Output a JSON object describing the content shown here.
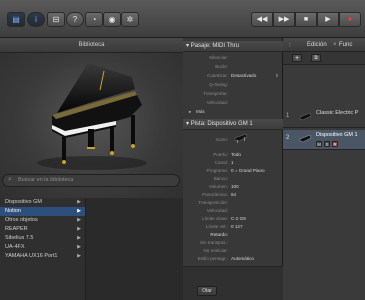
{
  "transport": {
    "rewind": "◀◀",
    "forward": "▶▶",
    "stop": "■",
    "play": "▶",
    "record": "●"
  },
  "library": {
    "title": "Biblioteca",
    "search_placeholder": "Buscar en la biblioteca",
    "items": [
      {
        "label": "Dispositivo GM",
        "selected": false
      },
      {
        "label": "Notion",
        "selected": true
      },
      {
        "label": "Otros objetos",
        "selected": false
      },
      {
        "label": "REAPER",
        "selected": false
      },
      {
        "label": "Sibelius 7.5",
        "selected": false
      },
      {
        "label": "UA-4FX",
        "selected": false
      },
      {
        "label": "YAMAHA UX16 Port1",
        "selected": false
      }
    ]
  },
  "inspector": {
    "midi_thru": {
      "title": "Pasaje: MIDI Thru",
      "rows": [
        {
          "label": "Silenciar:",
          "value": ""
        },
        {
          "label": "Bucle:",
          "value": ""
        },
        {
          "label": "Cuantizar:",
          "value": "Desactivado"
        },
        {
          "label": "Q-Swing:",
          "value": ""
        },
        {
          "label": "Transportar:",
          "value": ""
        },
        {
          "label": "Velocidad:",
          "value": ""
        }
      ],
      "more": "Más"
    },
    "track": {
      "title": "Pista: Dispositivo GM 1",
      "icon_label": "Icono:",
      "rows": [
        {
          "label": "Puerto:",
          "value": "Todo"
        },
        {
          "label": "Canal:",
          "value": "1"
        },
        {
          "label": "Programa:",
          "value": "0 = Grand Piano"
        },
        {
          "label": "Banco:",
          "value": ""
        },
        {
          "label": "Volumen:",
          "value": "100"
        },
        {
          "label": "Panorámica:",
          "value": "64"
        },
        {
          "label": "Transposición:",
          "value": ""
        },
        {
          "label": "Velocidad:",
          "value": ""
        },
        {
          "label": "Límite clave:",
          "value": "C-2      G8"
        },
        {
          "label": "Límite vel.:",
          "value": "0      127"
        },
        {
          "label": "Retardo:",
          "value": ""
        },
        {
          "label": "Sin transpos.:",
          "value": ""
        },
        {
          "label": "No reiniciar:",
          "value": ""
        },
        {
          "label": "Estilo pentagr.:",
          "value": "Automático"
        }
      ]
    }
  },
  "bottom": {
    "button_label": "Otar"
  },
  "tracks": {
    "tab_edit": "Edición",
    "tab_func": "Func",
    "add": "+",
    "items": [
      {
        "number": "1",
        "name": "Classic Electric P",
        "selected": false
      },
      {
        "number": "2",
        "name": "Dispositivo GM 1",
        "selected": true
      }
    ],
    "m_label": "M",
    "s_label": "S",
    "r_label": "R"
  }
}
